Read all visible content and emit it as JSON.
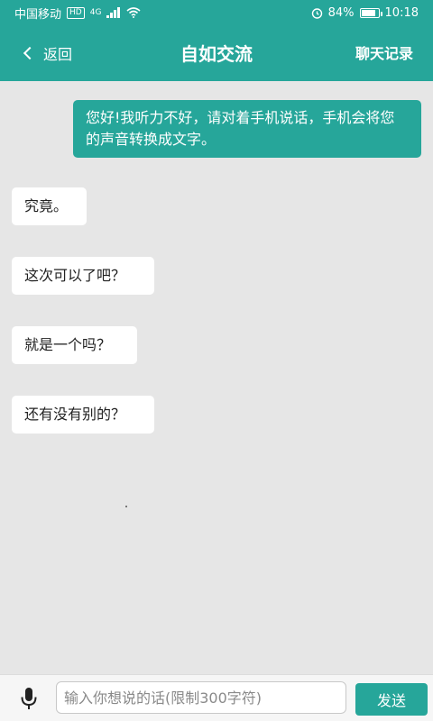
{
  "status_bar": {
    "carrier": "中国移动",
    "hd_badge": "HD",
    "network": "4G",
    "battery_percent": "84%",
    "battery_level": 0.84,
    "time": "10:18"
  },
  "nav": {
    "back_label": "返回",
    "title": "自如交流",
    "history_label": "聊天记录"
  },
  "messages": {
    "self_0": "您好!我听力不好，请对着手机说话，手机会将您的声音转换成文字。",
    "other_0": "究竟。",
    "other_1": "这次可以了吧？",
    "other_2": "就是一个吗？",
    "other_3": "还有没有别的？"
  },
  "input": {
    "placeholder": "输入你想说的话(限制300字符)",
    "value": "",
    "send_label": "发送"
  },
  "colors": {
    "accent": "#26a69a",
    "background": "#e6e6e6"
  },
  "icons": {
    "back": "chevron-left-icon",
    "mic": "microphone-icon",
    "signal": "signal-icon",
    "wifi": "wifi-icon",
    "alarm": "alarm-icon",
    "battery": "battery-icon"
  }
}
